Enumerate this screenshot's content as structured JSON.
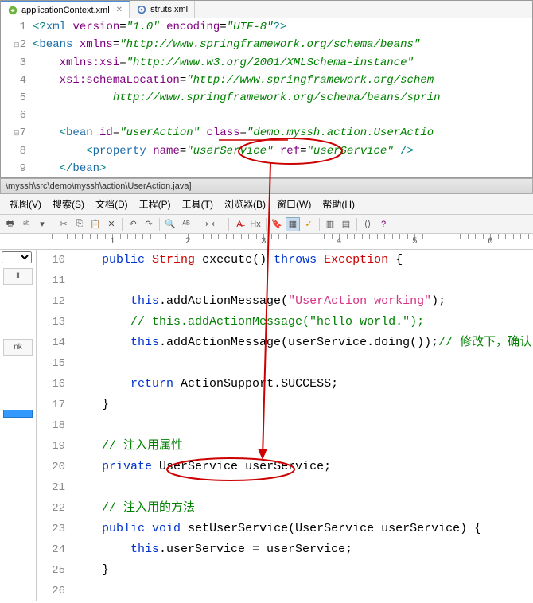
{
  "tabs": {
    "active_label": "applicationContext.xml",
    "inactive_label": "struts.xml"
  },
  "xml": {
    "lines": [
      {
        "n": "1",
        "text": "<?xml version=\"1.0\" encoding=\"UTF-8\"?>"
      },
      {
        "n": "2",
        "text": "<beans xmlns=\"http://www.springframework.org/schema/beans\""
      },
      {
        "n": "3",
        "text": "    xmlns:xsi=\"http://www.w3.org/2001/XMLSchema-instance\""
      },
      {
        "n": "4",
        "text": "    xsi:schemaLocation=\"http://www.springframework.org/schem"
      },
      {
        "n": "5",
        "text": "            http://www.springframework.org/schema/beans/sprin"
      },
      {
        "n": "6",
        "text": ""
      },
      {
        "n": "7",
        "text": "    <bean id=\"userAction\" class=\"demo.myssh.action.UserActio"
      },
      {
        "n": "8",
        "text": "        <property name=\"userService\" ref=\"userService\" />"
      },
      {
        "n": "9",
        "text": "    </bean>"
      }
    ]
  },
  "path": "\\myssh\\src\\demo\\myssh\\action\\UserAction.java]",
  "menus": [
    "视图(V)",
    "搜索(S)",
    "文档(D)",
    "工程(P)",
    "工具(T)",
    "浏览器(B)",
    "窗口(W)",
    "帮助(H)"
  ],
  "ruler": {
    "labels": [
      "1",
      "2",
      "3",
      "4",
      "5",
      "6"
    ]
  },
  "side": {
    "items": [
      "ll",
      "nk",
      ""
    ]
  },
  "java": {
    "lines": [
      {
        "n": "10",
        "t": "    public String execute() throws Exception {"
      },
      {
        "n": "11",
        "t": ""
      },
      {
        "n": "12",
        "t": "        this.addActionMessage(\"UserAction working\");"
      },
      {
        "n": "13",
        "t": "        // this.addActionMessage(\"hello world.\");"
      },
      {
        "n": "14",
        "t": "        this.addActionMessage(userService.doing());// 修改下，确认"
      },
      {
        "n": "15",
        "t": ""
      },
      {
        "n": "16",
        "t": "        return ActionSupport.SUCCESS;"
      },
      {
        "n": "17",
        "t": "    }"
      },
      {
        "n": "18",
        "t": ""
      },
      {
        "n": "19",
        "t": "    // 注入用属性"
      },
      {
        "n": "20",
        "t": "    private UserService userService;"
      },
      {
        "n": "21",
        "t": ""
      },
      {
        "n": "22",
        "t": "    // 注入用的方法"
      },
      {
        "n": "23",
        "t": "    public void setUserService(UserService userService) {"
      },
      {
        "n": "24",
        "t": "        this.userService = userService;"
      },
      {
        "n": "25",
        "t": "    }"
      },
      {
        "n": "26",
        "t": ""
      }
    ]
  }
}
